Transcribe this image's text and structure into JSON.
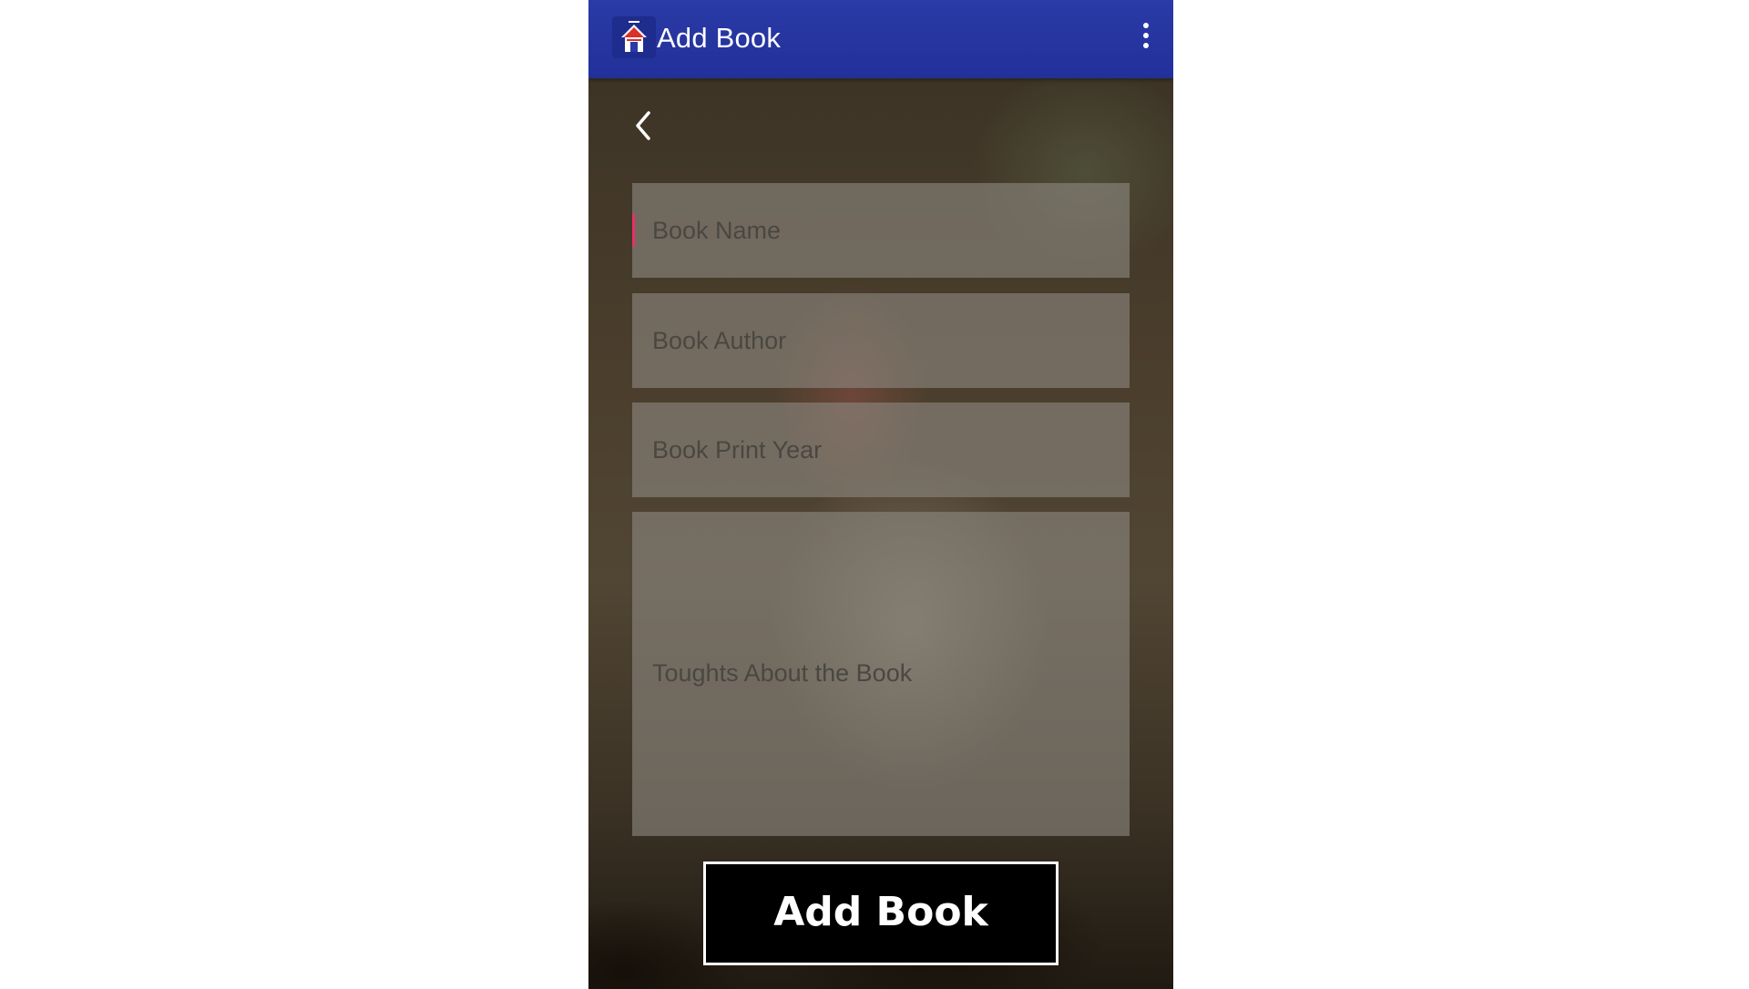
{
  "appbar": {
    "title": "Add Book",
    "logo_icon": "house-logo-icon",
    "menu_icon": "overflow-menu-icon",
    "background_color": "#22309a"
  },
  "nav": {
    "back_icon": "chevron-left-icon"
  },
  "form": {
    "book_name": {
      "placeholder": "Book Name",
      "value": ""
    },
    "book_author": {
      "placeholder": "Book Author",
      "value": ""
    },
    "book_print_year": {
      "placeholder": "Book Print Year",
      "value": ""
    },
    "thoughts": {
      "placeholder": "Toughts About the Book",
      "value": ""
    }
  },
  "actions": {
    "add_label": "Add Book"
  },
  "colors": {
    "cursor": "#e8306a",
    "button_bg": "#000000",
    "button_border": "#ffffff"
  }
}
